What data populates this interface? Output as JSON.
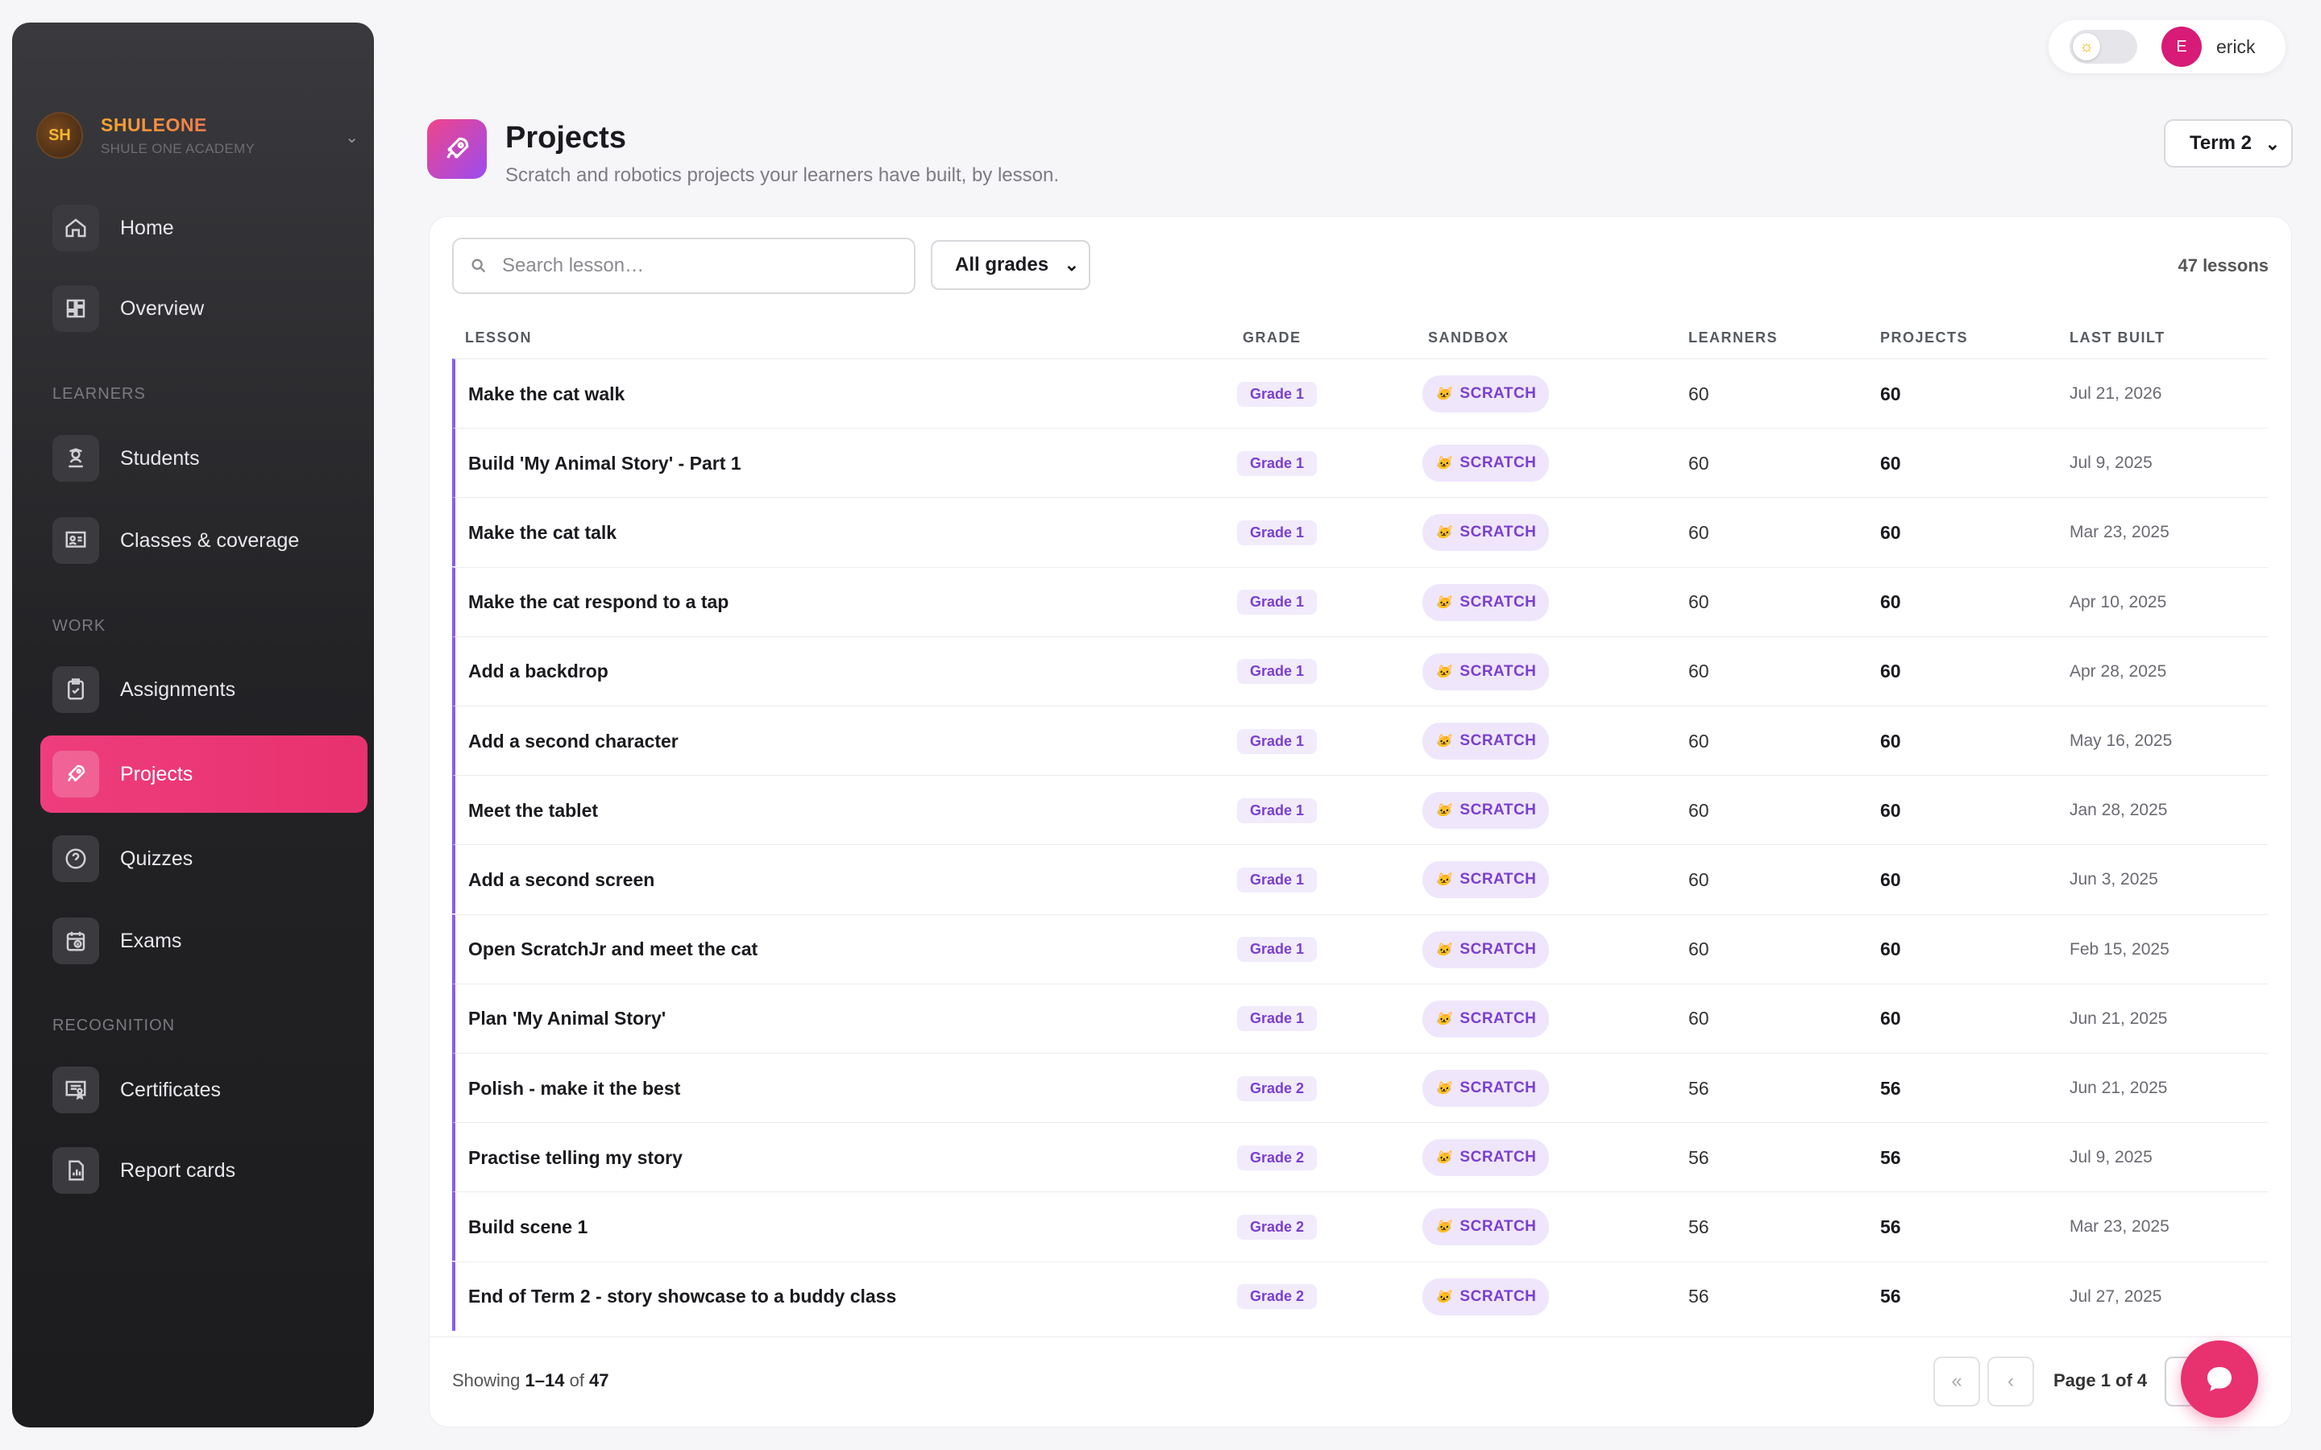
{
  "org": {
    "initials": "SH",
    "name": "SHULEONE",
    "subtitle": "SHULE ONE ACADEMY"
  },
  "nav": {
    "home": "Home",
    "overview": "Overview",
    "section_learners": "LEARNERS",
    "students": "Students",
    "classes": "Classes & coverage",
    "section_work": "WORK",
    "assignments": "Assignments",
    "projects": "Projects",
    "quizzes": "Quizzes",
    "exams": "Exams",
    "section_recognition": "RECOGNITION",
    "certificates": "Certificates",
    "report_cards": "Report cards"
  },
  "user": {
    "initial": "E",
    "name": "erick"
  },
  "header": {
    "title": "Projects",
    "subtitle": "Scratch and robotics projects your learners have built, by lesson.",
    "term": "Term 2"
  },
  "filters": {
    "search_placeholder": "Search lesson…",
    "grade": "All grades",
    "count": "47 lessons"
  },
  "table": {
    "headers": {
      "lesson": "LESSON",
      "grade": "GRADE",
      "sandbox": "SANDBOX",
      "learners": "LEARNERS",
      "projects": "PROJECTS",
      "last_built": "LAST BUILT"
    },
    "rows": [
      {
        "lesson": "Make the cat walk",
        "grade": "Grade 1",
        "sandbox": "SCRATCH",
        "learners": "60",
        "projects": "60",
        "last_built": "Jul 21, 2026"
      },
      {
        "lesson": "Build 'My Animal Story' - Part 1",
        "grade": "Grade 1",
        "sandbox": "SCRATCH",
        "learners": "60",
        "projects": "60",
        "last_built": "Jul 9, 2025"
      },
      {
        "lesson": "Make the cat talk",
        "grade": "Grade 1",
        "sandbox": "SCRATCH",
        "learners": "60",
        "projects": "60",
        "last_built": "Mar 23, 2025"
      },
      {
        "lesson": "Make the cat respond to a tap",
        "grade": "Grade 1",
        "sandbox": "SCRATCH",
        "learners": "60",
        "projects": "60",
        "last_built": "Apr 10, 2025"
      },
      {
        "lesson": "Add a backdrop",
        "grade": "Grade 1",
        "sandbox": "SCRATCH",
        "learners": "60",
        "projects": "60",
        "last_built": "Apr 28, 2025"
      },
      {
        "lesson": "Add a second character",
        "grade": "Grade 1",
        "sandbox": "SCRATCH",
        "learners": "60",
        "projects": "60",
        "last_built": "May 16, 2025"
      },
      {
        "lesson": "Meet the tablet",
        "grade": "Grade 1",
        "sandbox": "SCRATCH",
        "learners": "60",
        "projects": "60",
        "last_built": "Jan 28, 2025"
      },
      {
        "lesson": "Add a second screen",
        "grade": "Grade 1",
        "sandbox": "SCRATCH",
        "learners": "60",
        "projects": "60",
        "last_built": "Jun 3, 2025"
      },
      {
        "lesson": "Open ScratchJr and meet the cat",
        "grade": "Grade 1",
        "sandbox": "SCRATCH",
        "learners": "60",
        "projects": "60",
        "last_built": "Feb 15, 2025"
      },
      {
        "lesson": "Plan 'My Animal Story'",
        "grade": "Grade 1",
        "sandbox": "SCRATCH",
        "learners": "60",
        "projects": "60",
        "last_built": "Jun 21, 2025"
      },
      {
        "lesson": "Polish - make it the best",
        "grade": "Grade 2",
        "sandbox": "SCRATCH",
        "learners": "56",
        "projects": "56",
        "last_built": "Jun 21, 2025"
      },
      {
        "lesson": "Practise telling my story",
        "grade": "Grade 2",
        "sandbox": "SCRATCH",
        "learners": "56",
        "projects": "56",
        "last_built": "Jul 9, 2025"
      },
      {
        "lesson": "Build scene 1",
        "grade": "Grade 2",
        "sandbox": "SCRATCH",
        "learners": "56",
        "projects": "56",
        "last_built": "Mar 23, 2025"
      },
      {
        "lesson": "End of Term 2 - story showcase to a buddy class",
        "grade": "Grade 2",
        "sandbox": "SCRATCH",
        "learners": "56",
        "projects": "56",
        "last_built": "Jul 27, 2025"
      }
    ]
  },
  "pagination": {
    "showing_prefix": "Showing ",
    "range": "1–14",
    "of": " of ",
    "total": "47",
    "page_label": "Page 1 of 4"
  },
  "colors": {
    "accent": "#e8316f",
    "purple": "#7a3fd0"
  }
}
